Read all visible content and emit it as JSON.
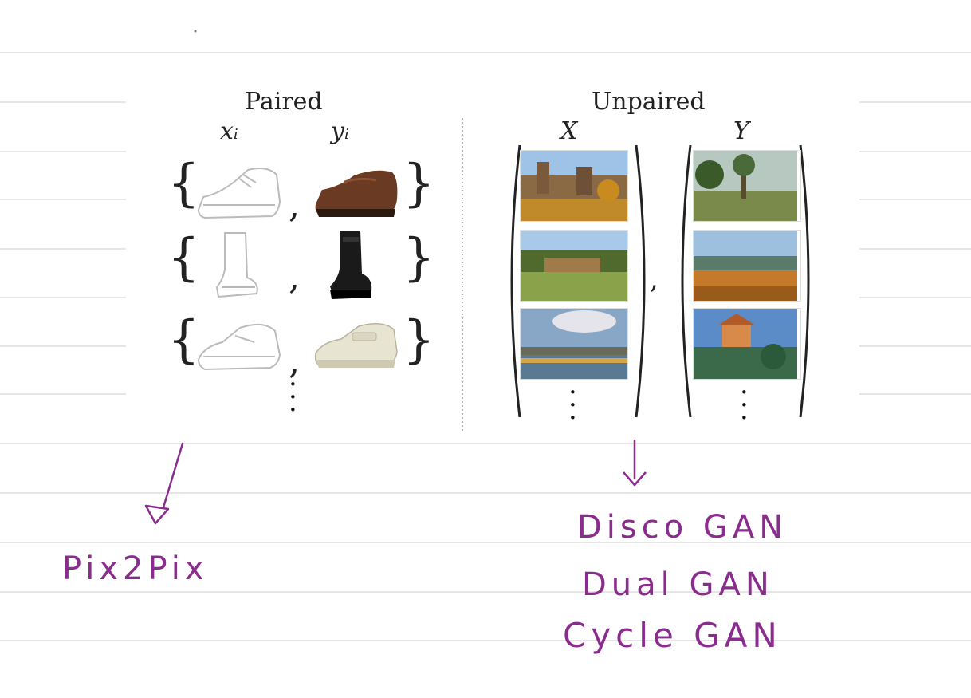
{
  "figure": {
    "paired": {
      "title": "Paired",
      "x_label": "x",
      "x_sub": "i",
      "y_label": "y",
      "y_sub": "i"
    },
    "unpaired": {
      "title": "Unpaired",
      "x_label": "X",
      "y_label": "Y"
    }
  },
  "annotations": {
    "left": "Pix2Pix",
    "right": [
      "Disco GAN",
      "Dual GAN",
      "Cycle GAN"
    ],
    "ink_color": "#8a2c8e"
  }
}
